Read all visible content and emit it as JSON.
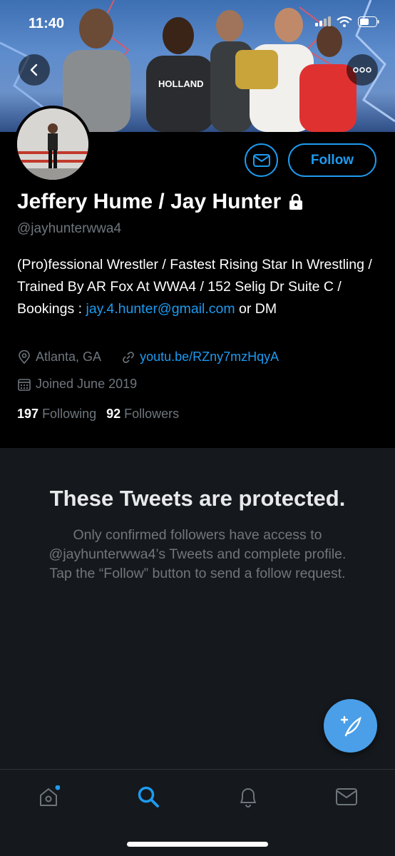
{
  "status_bar": {
    "time": "11:40"
  },
  "profile": {
    "display_name": "Jeffery Hume / Jay Hunter",
    "handle": "@jayhunterwwa4",
    "bio_text": "(Pro)fessional Wrestler / Fastest Rising Star In Wrestling / Trained By AR Fox At WWA4 / 152 Selig Dr Suite C / Bookings :",
    "bio_email": "jay.4.hunter@gmail.com",
    "bio_suffix": " or DM",
    "location": "Atlanta, GA",
    "website": "youtu.be/RZny7mzHqyA",
    "joined": "Joined June 2019",
    "following_count": "197",
    "following_label": "Following",
    "followers_count": "92",
    "followers_label": "Followers",
    "locked": true
  },
  "actions": {
    "follow_label": "Follow"
  },
  "protected": {
    "title": "These Tweets are protected.",
    "body": "Only confirmed followers have access to @jayhunterwwa4’s Tweets and complete profile. Tap the “Follow” button to send a follow request."
  },
  "bottom_nav": [
    {
      "name": "home",
      "icon": "home-icon",
      "active": false,
      "badge": true
    },
    {
      "name": "search",
      "icon": "search-icon",
      "active": true
    },
    {
      "name": "notifications",
      "icon": "bell-icon",
      "active": false
    },
    {
      "name": "messages",
      "icon": "mail-icon",
      "active": false
    }
  ],
  "colors": {
    "accent": "#1d9bf0",
    "muted": "#6e767d",
    "panel": "#15181c",
    "fab": "#4a9fe8"
  }
}
